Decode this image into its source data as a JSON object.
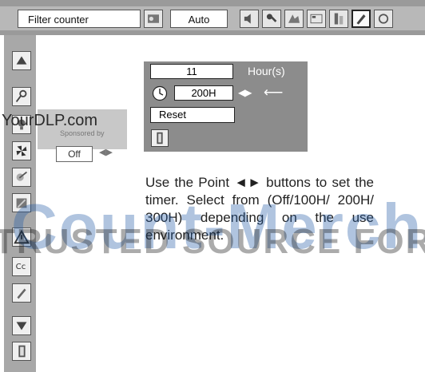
{
  "toolbar": {
    "menu_title": "Filter counter",
    "mode_value": "Auto",
    "icons": [
      "image-adjust-icon",
      "audio-icon",
      "tools-icon",
      "screen-icon",
      "info-icon",
      "setting-icon",
      "network-icon"
    ]
  },
  "sidebar": {
    "icons": [
      "up-arrow-icon",
      "key-icon",
      "lamp-icon",
      "fan-icon",
      "filter-icon",
      "notebook-icon",
      "warning-icon",
      "cc-icon",
      "pen-icon",
      "down-arrow-icon",
      "exit-icon"
    ]
  },
  "dialog": {
    "hours_value": "11",
    "hours_label": "Hour(s)",
    "timer_value": "200H",
    "timer_arrows": "◀▶",
    "back_symbol": "⟵",
    "reset_label": "Reset"
  },
  "ghost": {
    "off_value": "Off",
    "small_text": "Sponsored by",
    "arrows": "◀▶"
  },
  "instructions": "Use the Point ◄► buttons to set the timer. Select from (Off/100H/ 200H/ 300H) depending on the use environment.",
  "watermark": {
    "site": "YourDLP.com",
    "brand": "Count-Merchan",
    "tagline": "TRUSTED SOURCE FOR PI"
  }
}
